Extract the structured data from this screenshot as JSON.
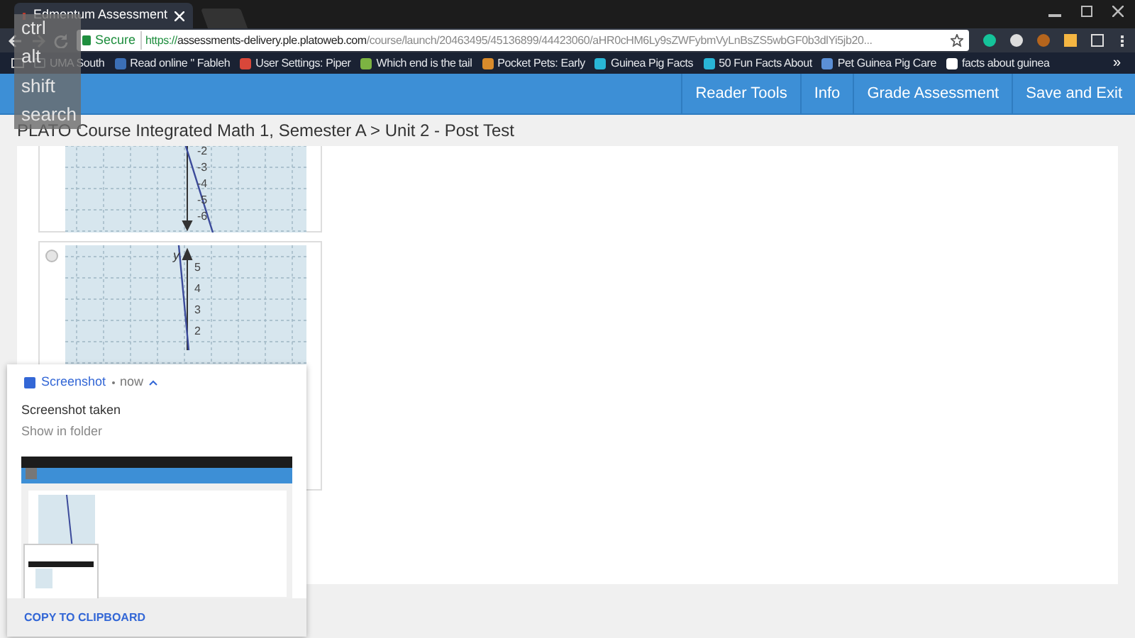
{
  "browser": {
    "tab_title": "Edmentum Assessment",
    "secure_label": "Secure",
    "url_scheme": "https://",
    "url_host": "assessments-delivery.ple.platoweb.com",
    "url_path": "/course/launch/20463495/45136899/44423060/aHR0cHM6Ly9sZWFybmVyLnBsZS5wbGF0b3dlYi5jb20...",
    "bookmarks": [
      {
        "label": "UMA South"
      },
      {
        "label": "Read online \" Fableh",
        "color": "#3b6fb6"
      },
      {
        "label": "User Settings: Piper",
        "color": "#d9473a"
      },
      {
        "label": "Which end is the tail",
        "color": "#7cb342"
      },
      {
        "label": "Pocket Pets: Early",
        "color": "#d98b2b"
      },
      {
        "label": "Guinea Pig Facts",
        "color": "#29b6d6"
      },
      {
        "label": "50 Fun Facts About",
        "color": "#29b6d6"
      },
      {
        "label": "Pet Guinea Pig Care",
        "color": "#5b8fd6"
      },
      {
        "label": "facts about guinea",
        "color": "#ffffff"
      }
    ],
    "more_bookmarks": "»"
  },
  "keyboard_overlay": {
    "keys": [
      "ctrl",
      "alt",
      "shift",
      "search"
    ]
  },
  "header": {
    "buttons": [
      "Reader Tools",
      "Info",
      "Grade Assessment",
      "Save and Exit"
    ]
  },
  "breadcrumb": "PLATO Course Integrated Math 1, Semester A > Unit 2 - Post Test",
  "answer_options": [
    {
      "kind": "graph_only",
      "y_labels": [
        "-2",
        "-3",
        "-4",
        "-5",
        "-6"
      ]
    },
    {
      "kind": "radio",
      "selected": false,
      "y_labels": [
        "5",
        "4",
        "3",
        "2"
      ],
      "axis_label": "y"
    }
  ],
  "notification": {
    "app": "Screenshot",
    "time": "now",
    "title": "Screenshot taken",
    "subtitle": "Show in folder",
    "action": "COPY TO CLIPBOARD"
  }
}
